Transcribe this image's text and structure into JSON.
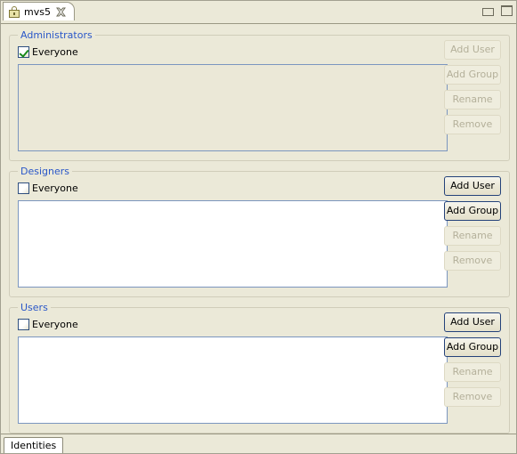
{
  "window": {
    "tab": {
      "lock_icon": "lock-icon",
      "title": "mvs5",
      "close_icon": "close-icon"
    },
    "controls": {
      "minimize": "minimize-icon",
      "maximize": "maximize-icon"
    }
  },
  "colors": {
    "background": "#ebe9d8",
    "group_label": "#2a57c8",
    "listbox_border": "#7b96bf",
    "listbox_enabled_bg": "#ffffff",
    "listbox_disabled_bg": "#ebe8d7",
    "button_enabled_border": "#24427a",
    "button_disabled_text": "#b4b09a",
    "checkmark": "#1a8a1a"
  },
  "groups": [
    {
      "label": "Administrators",
      "everyone": {
        "label": "Everyone",
        "checked": true
      },
      "list": {
        "enabled": false,
        "items": []
      },
      "buttons": [
        {
          "label": "Add User",
          "enabled": false
        },
        {
          "label": "Add Group",
          "enabled": false
        },
        {
          "label": "Rename",
          "enabled": false
        },
        {
          "label": "Remove",
          "enabled": false
        }
      ]
    },
    {
      "label": "Designers",
      "everyone": {
        "label": "Everyone",
        "checked": false
      },
      "list": {
        "enabled": true,
        "items": []
      },
      "buttons": [
        {
          "label": "Add User",
          "enabled": true
        },
        {
          "label": "Add Group",
          "enabled": true
        },
        {
          "label": "Rename",
          "enabled": false
        },
        {
          "label": "Remove",
          "enabled": false
        }
      ]
    },
    {
      "label": "Users",
      "everyone": {
        "label": "Everyone",
        "checked": false
      },
      "list": {
        "enabled": true,
        "items": []
      },
      "buttons": [
        {
          "label": "Add User",
          "enabled": true
        },
        {
          "label": "Add Group",
          "enabled": true
        },
        {
          "label": "Rename",
          "enabled": false
        },
        {
          "label": "Remove",
          "enabled": false
        }
      ]
    }
  ],
  "bottom_tabs": [
    {
      "label": "Identities",
      "selected": true
    }
  ]
}
